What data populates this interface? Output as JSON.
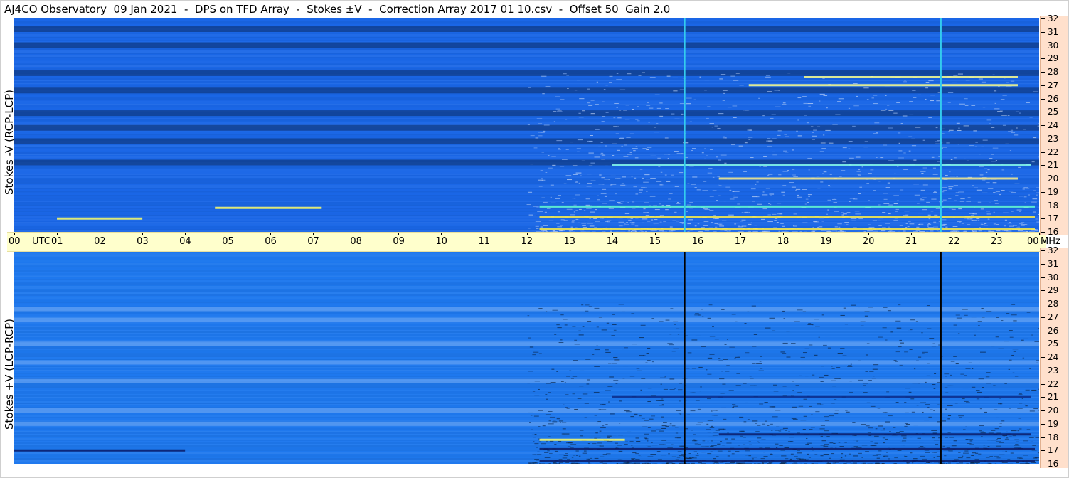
{
  "header": {
    "title": "AJ4CO Observatory  09 Jan 2021  -  DPS on TFD Array  -  Stokes ±V  -  Correction Array 2017 01 10.csv  -  Offset 50  Gain 2.0"
  },
  "chart_data": [
    {
      "type": "heatmap",
      "panel": "top",
      "ylabel": "Stokes -V (RCP-LCP)",
      "xlabel": "UTC",
      "y_unit": "MHz",
      "x_ticks": [
        "00",
        "01",
        "02",
        "03",
        "04",
        "05",
        "06",
        "07",
        "08",
        "09",
        "10",
        "11",
        "12",
        "13",
        "14",
        "15",
        "16",
        "17",
        "18",
        "19",
        "20",
        "21",
        "22",
        "23",
        "00"
      ],
      "y_ticks": [
        "16",
        "17",
        "18",
        "19",
        "20",
        "21",
        "22",
        "23",
        "24",
        "25",
        "26",
        "27",
        "28",
        "29",
        "30",
        "31",
        "32"
      ],
      "xlim": [
        0,
        24
      ],
      "ylim": [
        16,
        32
      ],
      "base_color": "#1a66e6",
      "dark_bands_mhz": [
        31.2,
        30.0,
        27.9,
        26.6,
        24.9,
        23.8,
        22.8,
        21.2
      ],
      "vertical_lines_utc": [
        15.7,
        21.7
      ],
      "vertical_line_color": "#33ccee",
      "emission_features": [
        {
          "utc_start": 12.3,
          "utc_end": 23.9,
          "mhz": 17.1,
          "color": "#ffee44"
        },
        {
          "utc_start": 12.3,
          "utc_end": 23.9,
          "mhz": 16.2,
          "color": "#ffee44"
        },
        {
          "utc_start": 12.3,
          "utc_end": 23.9,
          "mhz": 17.9,
          "color": "#66ffcc"
        },
        {
          "utc_start": 4.7,
          "utc_end": 7.2,
          "mhz": 17.8,
          "color": "#ffff66"
        },
        {
          "utc_start": 1.0,
          "utc_end": 3.0,
          "mhz": 17.0,
          "color": "#ffff66"
        },
        {
          "utc_start": 14.0,
          "utc_end": 23.8,
          "mhz": 21.0,
          "color": "#88ffee"
        },
        {
          "utc_start": 16.5,
          "utc_end": 23.5,
          "mhz": 20.0,
          "color": "#ffee88"
        },
        {
          "utc_start": 17.2,
          "utc_end": 23.5,
          "mhz": 27.0,
          "color": "#ffff88"
        },
        {
          "utc_start": 18.5,
          "utc_end": 23.5,
          "mhz": 27.6,
          "color": "#ffff88"
        }
      ]
    },
    {
      "type": "heatmap",
      "panel": "bottom",
      "ylabel": "Stokes +V (LCP-RCP)",
      "xlabel": "UTC",
      "y_unit": "MHz",
      "x_ticks": [
        "00",
        "01",
        "02",
        "03",
        "04",
        "05",
        "06",
        "07",
        "08",
        "09",
        "10",
        "11",
        "12",
        "13",
        "14",
        "15",
        "16",
        "17",
        "18",
        "19",
        "20",
        "21",
        "22",
        "23",
        "00"
      ],
      "y_ticks": [
        "16",
        "17",
        "18",
        "19",
        "20",
        "21",
        "22",
        "23",
        "24",
        "25",
        "26",
        "27",
        "28",
        "29",
        "30",
        "31",
        "32"
      ],
      "xlim": [
        0,
        24
      ],
      "ylim": [
        16,
        32
      ],
      "base_color": "#1e78ee",
      "light_bands_mhz": [
        27.6,
        26.8,
        25.0,
        23.6,
        22.2,
        20.0,
        19.0
      ],
      "vertical_lines_utc": [
        15.7,
        21.7
      ],
      "vertical_line_color": "#000000",
      "emission_features": [
        {
          "utc_start": 12.3,
          "utc_end": 23.9,
          "mhz": 17.1,
          "color": "#0a1a66"
        },
        {
          "utc_start": 12.3,
          "utc_end": 23.9,
          "mhz": 16.2,
          "color": "#0a1a66"
        },
        {
          "utc_start": 12.3,
          "utc_end": 14.3,
          "mhz": 17.8,
          "color": "#ffff66"
        },
        {
          "utc_start": 0.0,
          "utc_end": 4.0,
          "mhz": 17.0,
          "color": "#0a1a66"
        },
        {
          "utc_start": 14.0,
          "utc_end": 23.8,
          "mhz": 21.0,
          "color": "#0a2a88"
        },
        {
          "utc_start": 16.5,
          "utc_end": 23.8,
          "mhz": 18.2,
          "color": "#0a1a66"
        }
      ]
    }
  ],
  "time_axis": {
    "utc_label": "UTC",
    "mhz_label": "MHz"
  }
}
